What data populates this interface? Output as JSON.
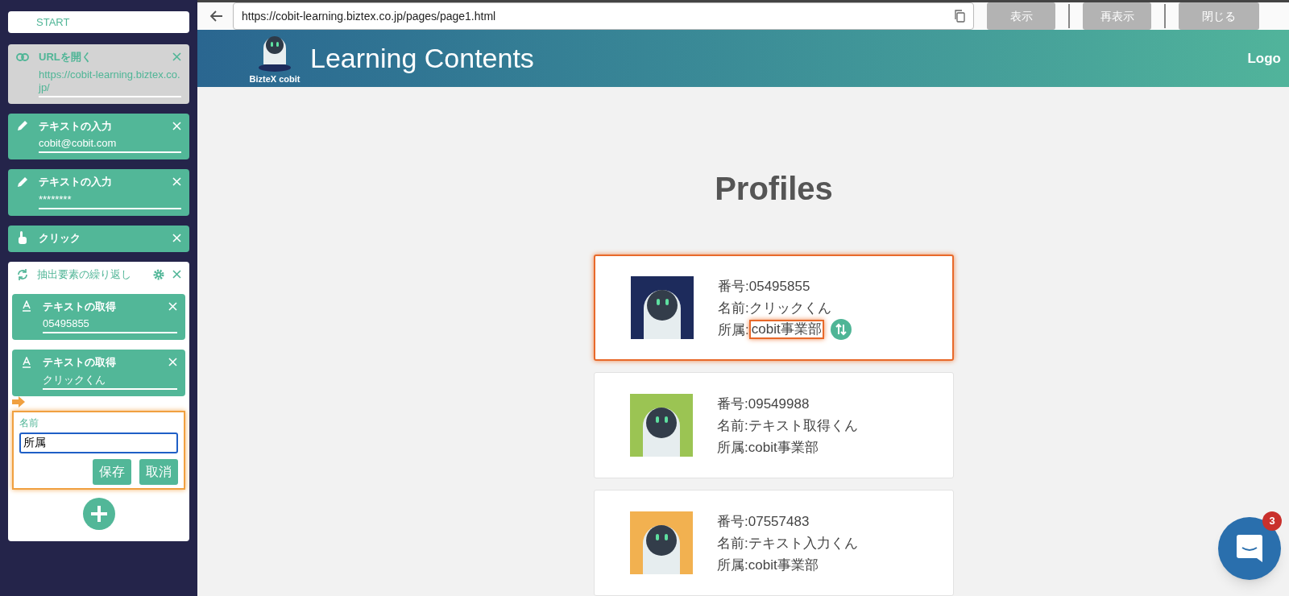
{
  "sidebar": {
    "steps": [
      {
        "kind": "start",
        "label": "START"
      },
      {
        "kind": "open_url",
        "label": "URLを開く",
        "value": "https://cobit-learning.biztex.co.jp/",
        "disabled": true
      },
      {
        "kind": "input_text",
        "label": "テキストの入力",
        "value": "cobit@cobit.com",
        "disabled": false
      },
      {
        "kind": "input_text",
        "label": "テキストの入力",
        "value": "********",
        "disabled": false
      },
      {
        "kind": "click",
        "label": "クリック",
        "disabled": false
      },
      {
        "kind": "loop",
        "label": "抽出要素の繰り返し",
        "children": [
          {
            "kind": "get_text",
            "label": "テキストの取得",
            "value": "05495855",
            "disabled": false
          },
          {
            "kind": "get_text",
            "label": "テキストの取得",
            "value": "クリックくん",
            "disabled": false
          }
        ],
        "form": {
          "label": "名前",
          "value": "所属",
          "buttons": [
            "保存",
            "取消"
          ]
        }
      }
    ]
  },
  "browser": {
    "url": "https://cobit-learning.biztex.co.jp/pages/page1.html",
    "buttons": [
      "表示",
      "再表示",
      "閉じる"
    ]
  },
  "site": {
    "logo_text": "BizteX cobit",
    "title": "Learning Contents",
    "nav": "Logo",
    "heading": "Profiles",
    "profiles": [
      {
        "color": "#1d2b5c",
        "selected": true,
        "fields": [
          {
            "label": "番号:",
            "value": "05495855",
            "highlighted": false
          },
          {
            "label": "名前:",
            "value": "クリックくん",
            "highlighted": false
          },
          {
            "label": "所属:",
            "value": "cobit事業部",
            "highlighted": true
          }
        ]
      },
      {
        "color": "#9bc453",
        "selected": false,
        "fields": [
          {
            "label": "番号:",
            "value": "09549988",
            "highlighted": false
          },
          {
            "label": "名前:",
            "value": "テキスト取得くん",
            "highlighted": false
          },
          {
            "label": "所属:",
            "value": "cobit事業部",
            "highlighted": false
          }
        ]
      },
      {
        "color": "#f2b150",
        "selected": false,
        "fields": [
          {
            "label": "番号:",
            "value": "07557483",
            "highlighted": false
          },
          {
            "label": "名前:",
            "value": "テキスト入力くん",
            "highlighted": false
          },
          {
            "label": "所属:",
            "value": "cobit事業部",
            "highlighted": false
          }
        ]
      }
    ]
  },
  "chat": {
    "badge": "3"
  }
}
